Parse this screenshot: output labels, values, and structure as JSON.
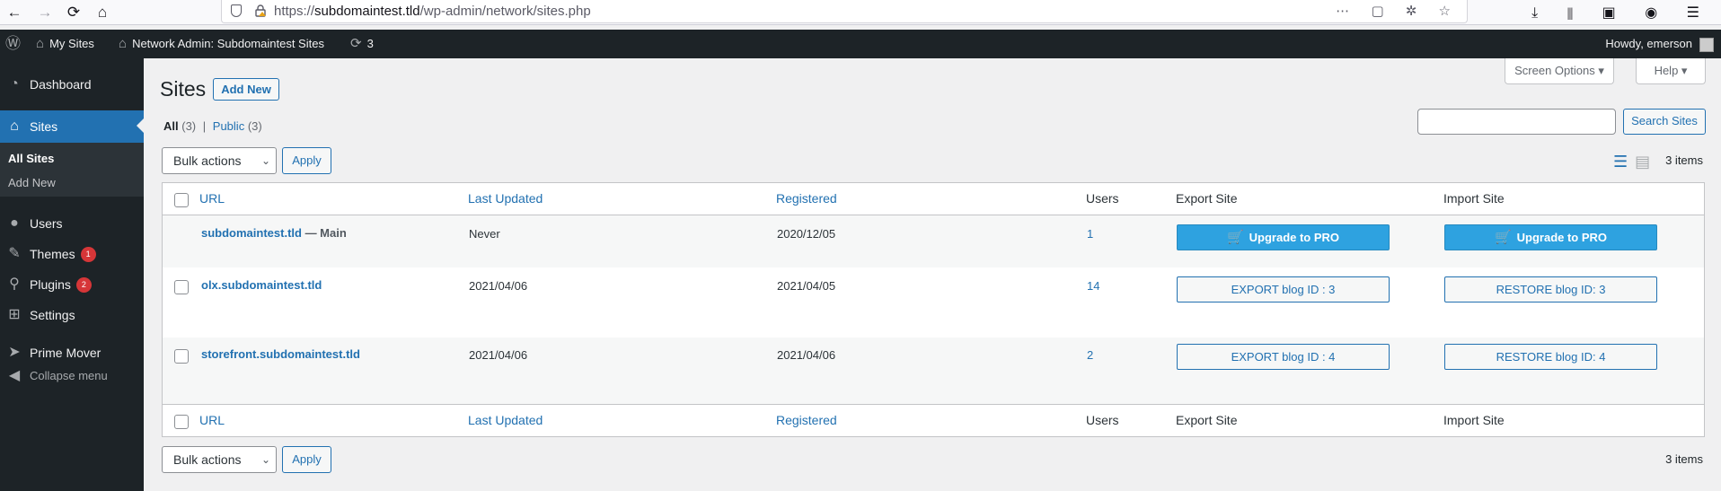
{
  "browser": {
    "back": "←",
    "forward": "→",
    "reload": "⟳",
    "home": "⌂",
    "url_prefix": "https://",
    "url_host": "subdomaintest.tld",
    "url_path": "/wp-admin/network/sites.php",
    "url_actions": "⋯ ▢ ✲ ☆",
    "toolbar_icons": "⤓ ⦀ ▣ ◉ ☰"
  },
  "adminbar": {
    "wp_logo": "Ⓦ",
    "my_sites": "My Sites",
    "network_admin": "Network Admin: Subdomaintest Sites",
    "updates_icon": "⟳",
    "updates_count": "3",
    "howdy": "Howdy, emerson"
  },
  "menu": {
    "dashboard": "Dashboard",
    "sites": "Sites",
    "all_sites": "All Sites",
    "add_new": "Add New",
    "users": "Users",
    "themes": "Themes",
    "themes_badge": "1",
    "plugins": "Plugins",
    "plugins_badge": "2",
    "settings": "Settings",
    "prime_mover": "Prime Mover",
    "collapse": "Collapse menu"
  },
  "header": {
    "screen_options": "Screen Options ▾",
    "help": "Help ▾",
    "title": "Sites",
    "add_new": "Add New"
  },
  "filters": {
    "all": "All",
    "all_count": "(3)",
    "separator": "|",
    "public": "Public",
    "public_count": "(3)"
  },
  "search": {
    "button": "Search Sites",
    "placeholder": ""
  },
  "bulk": {
    "label": "Bulk actions",
    "apply": "Apply"
  },
  "items_count": "3 items",
  "columns": {
    "url": "URL",
    "last_updated": "Last Updated",
    "registered": "Registered",
    "users": "Users",
    "export": "Export Site",
    "import": "Import Site"
  },
  "rows": [
    {
      "site": "subdomaintest.tld",
      "suffix": " — Main",
      "last_updated": "Never",
      "registered": "2020/12/05",
      "users": "1",
      "export": "Upgrade to PRO",
      "import": "Upgrade to PRO"
    },
    {
      "site": "olx.subdomaintest.tld",
      "suffix": "",
      "last_updated": "2021/04/06",
      "registered": "2021/04/05",
      "users": "14",
      "export": "EXPORT blog ID : 3",
      "import": "RESTORE blog ID: 3"
    },
    {
      "site": "storefront.subdomaintest.tld",
      "suffix": "",
      "last_updated": "2021/04/06",
      "registered": "2021/04/06",
      "users": "2",
      "export": "EXPORT blog ID : 4",
      "import": "RESTORE blog ID: 4"
    }
  ],
  "colors": {
    "accent": "#2271b1",
    "pro_button": "#2ea2e0",
    "admin_dark": "#1d2327",
    "badge": "#d63638"
  }
}
